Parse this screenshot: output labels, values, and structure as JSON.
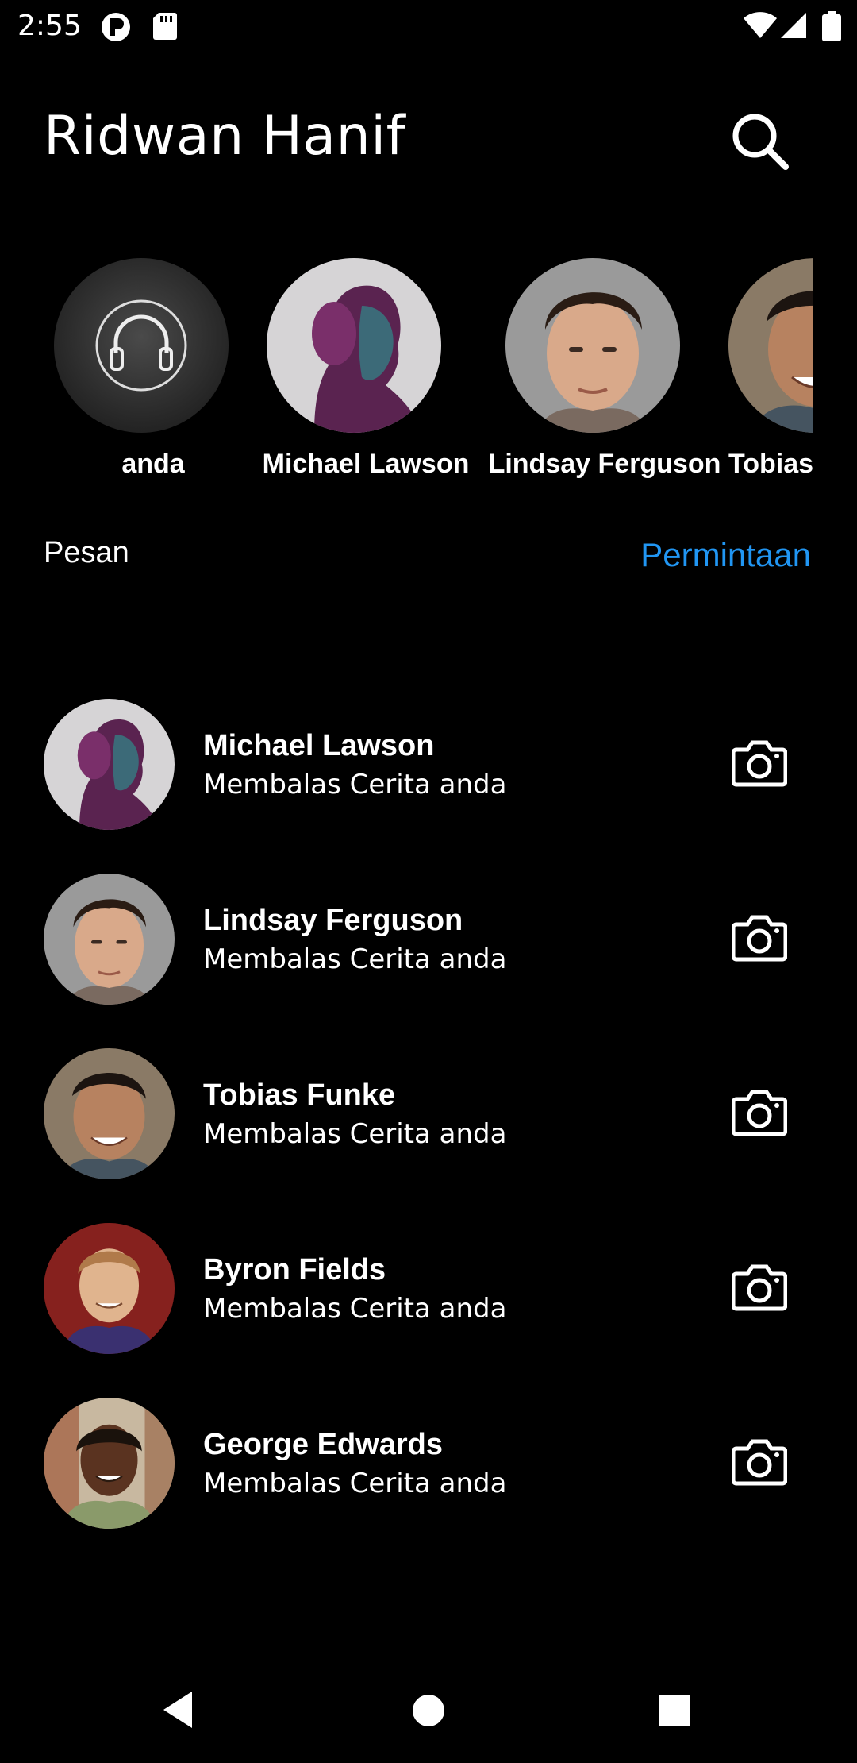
{
  "status_bar": {
    "time": "2:55",
    "icons": [
      "app-notification-icon",
      "sd-card-icon",
      "wifi-icon",
      "signal-icon",
      "battery-icon"
    ]
  },
  "header": {
    "title": "Ridwan Hanif",
    "search_icon": "search-icon"
  },
  "stories": [
    {
      "name": "anda",
      "avatar": "headphones-avatar"
    },
    {
      "name": "Michael Lawson",
      "avatar": "purple-woman-avatar"
    },
    {
      "name": "Lindsay Ferguson",
      "avatar": "young-man-avatar"
    },
    {
      "name": "Tobias",
      "avatar": "smiling-man-avatar"
    }
  ],
  "tabs": {
    "messages": "Pesan",
    "requests": "Permintaan"
  },
  "conversations": [
    {
      "name": "Michael Lawson",
      "message": "Membalas Cerita anda"
    },
    {
      "name": "Lindsay Ferguson",
      "message": "Membalas Cerita anda"
    },
    {
      "name": "Tobias Funke",
      "message": "Membalas Cerita anda"
    },
    {
      "name": "Byron Fields",
      "message": "Membalas Cerita anda"
    },
    {
      "name": "George Edwards",
      "message": "Membalas Cerita anda"
    }
  ],
  "colors": {
    "background": "#000000",
    "accent": "#2196F3",
    "text": "#FFFFFF"
  },
  "nav": [
    "back-icon",
    "home-icon",
    "recents-icon"
  ]
}
